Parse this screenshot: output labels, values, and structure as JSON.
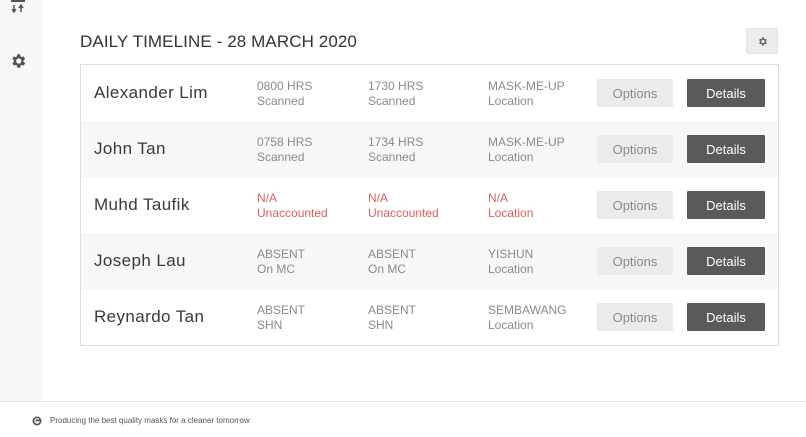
{
  "sidebar": {
    "icons": [
      "transfer-icon",
      "gear-icon"
    ]
  },
  "header": {
    "title": "DAILY TIMELINE - 28 MARCH 2020",
    "settings_icon": "gear-icon"
  },
  "rows": [
    {
      "name": "Alexander Lim",
      "in_time": "0800 HRS",
      "in_status": "Scanned",
      "out_time": "1730 HRS",
      "out_status": "Scanned",
      "location": "MASK-ME-UP",
      "location_label": "Location",
      "options_label": "Options",
      "details_label": "Details"
    },
    {
      "name": "John Tan",
      "in_time": "0758 HRS",
      "in_status": "Scanned",
      "out_time": "1734 HRS",
      "out_status": "Scanned",
      "location": "MASK-ME-UP",
      "location_label": "Location",
      "options_label": "Options",
      "details_label": "Details"
    },
    {
      "name": "Muhd Taufik",
      "in_time": "N/A",
      "in_status": "Unaccounted",
      "out_time": "N/A",
      "out_status": "Unaccounted",
      "location": "N/A",
      "location_label": "Location",
      "options_label": "Options",
      "details_label": "Details"
    },
    {
      "name": "Joseph Lau",
      "in_time": "ABSENT",
      "in_status": "On MC",
      "out_time": "ABSENT",
      "out_status": "On MC",
      "location": "YISHUN",
      "location_label": "Location",
      "options_label": "Options",
      "details_label": "Details"
    },
    {
      "name": "Reynardo Tan",
      "in_time": "ABSENT",
      "in_status": "SHN",
      "out_time": "ABSENT",
      "out_status": "SHN",
      "location": "SEMBAWANG",
      "location_label": "Location",
      "options_label": "Options",
      "details_label": "Details"
    }
  ],
  "footer": {
    "text": "Producing the best quality masks for a cleaner tomorrow",
    "icon": "brand-logo-icon"
  },
  "colors": {
    "warning": "#e06060",
    "details_button": "#5a5a5a",
    "options_button": "#ebebeb"
  }
}
